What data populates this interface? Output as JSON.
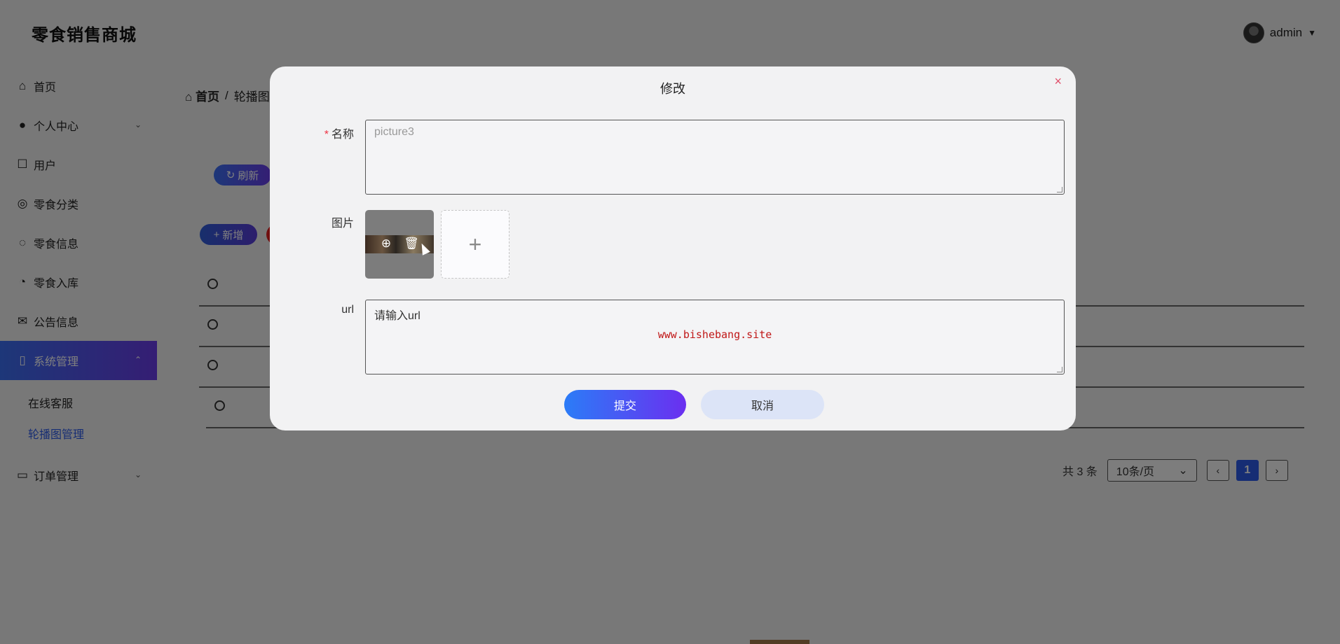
{
  "app": {
    "title": "零食销售商城"
  },
  "user": {
    "name": "admin"
  },
  "sidebar": {
    "items": [
      {
        "label": "首页",
        "icon": "home-icon"
      },
      {
        "label": "个人中心",
        "icon": "person-icon"
      },
      {
        "label": "用户",
        "icon": "user-icon"
      },
      {
        "label": "零食分类",
        "icon": "category-icon"
      },
      {
        "label": "零食信息",
        "icon": "chat-icon"
      },
      {
        "label": "零食入库",
        "icon": "pie-chart-icon"
      },
      {
        "label": "公告信息",
        "icon": "mail-icon"
      },
      {
        "label": "系统管理",
        "icon": "book-icon"
      }
    ],
    "system_sub": [
      "在线客服",
      "轮播图管理"
    ],
    "order_item": {
      "label": "订单管理",
      "icon": "message-icon"
    }
  },
  "breadcrumb": {
    "home": "首页",
    "separator": "/",
    "current": "轮播图"
  },
  "toolbar": {
    "refresh_label": "刷新",
    "add_label": "新增"
  },
  "pagination": {
    "total_text": "共 3 条",
    "page_size": "10条/页",
    "current_page": "1"
  },
  "modal": {
    "title": "修改",
    "close_icon": "×",
    "name_label": "名称",
    "name_value": "picture3",
    "picture_label": "图片",
    "url_label": "url",
    "url_placeholder": "请输入url",
    "watermark": "www.bishebang.site",
    "submit_label": "提交",
    "cancel_label": "取消"
  },
  "colors": {
    "accent": "#2d5be8",
    "gradient_start": "#2b7cf7",
    "gradient_end": "#6b2ff0",
    "danger": "#e02020"
  }
}
